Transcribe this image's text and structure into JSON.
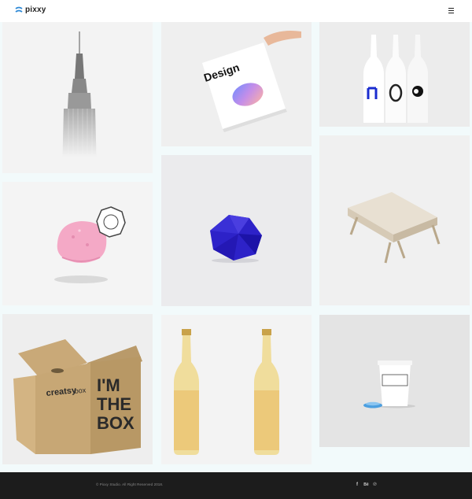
{
  "brand": {
    "name": "pixxy",
    "accent": "#2f8ad6"
  },
  "header": {
    "menu_icon": "hamburger-icon"
  },
  "gallery": {
    "items": [
      {
        "subject": "skyscraper",
        "background": "#f3f3f3"
      },
      {
        "subject": "design-poster",
        "background": "#efefef",
        "poster_title": "Design"
      },
      {
        "subject": "white-bottles",
        "background": "#ececec"
      },
      {
        "subject": "ice-cream",
        "background": "#f4f4f4"
      },
      {
        "subject": "blue-polyhedron",
        "background": "#ebebed"
      },
      {
        "subject": "wooden-table",
        "background": "#f0f0f0"
      },
      {
        "subject": "cardboard-box",
        "background": "#eeeeee",
        "box_text": [
          "I'M",
          "THE",
          "BOX"
        ],
        "box_brand": "creatsy",
        "box_brand_suffix": "box"
      },
      {
        "subject": "beer-bottles",
        "background": "#f3f3f3"
      },
      {
        "subject": "coffee-cup",
        "background": "#e4e4e4"
      }
    ]
  },
  "footer": {
    "copyright": "© Pixxy Studio. All Right Reserved 2018.",
    "social": [
      {
        "icon": "facebook-icon",
        "glyph": "f"
      },
      {
        "icon": "behance-icon",
        "glyph": "Bē"
      },
      {
        "icon": "pinterest-icon",
        "glyph": "℗"
      }
    ]
  }
}
